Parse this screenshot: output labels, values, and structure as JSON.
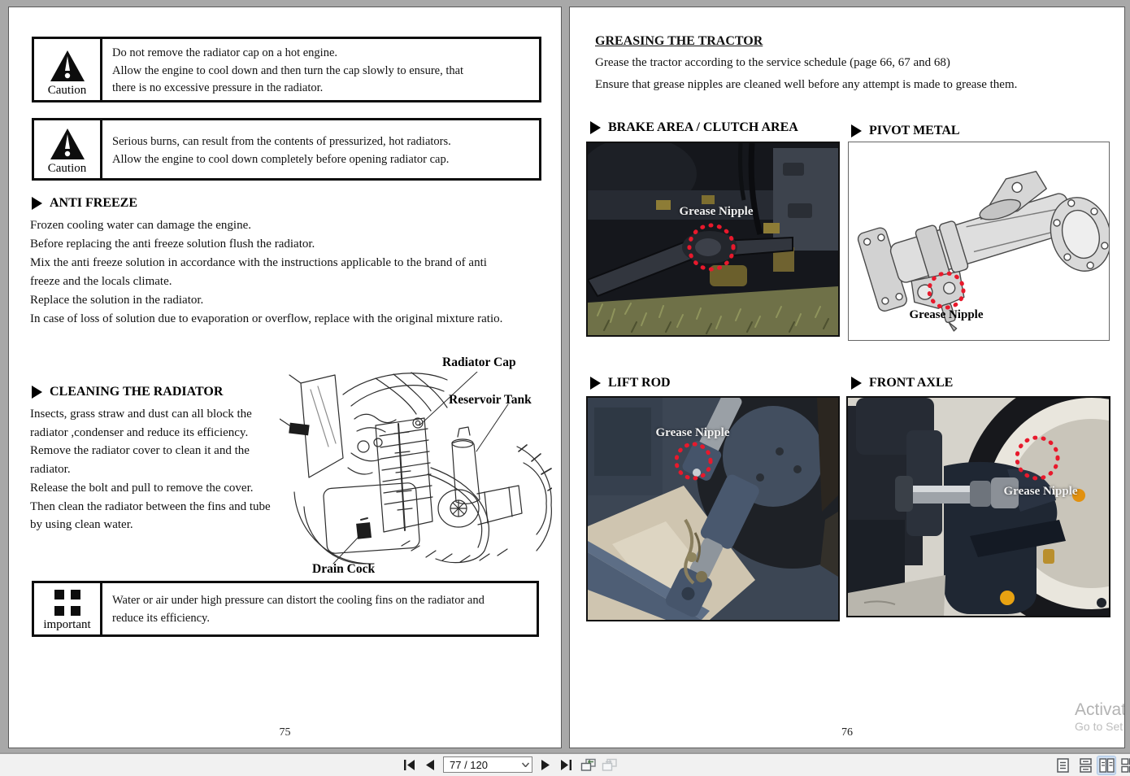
{
  "left_page": {
    "page_number": "75",
    "caution_boxes": [
      {
        "label": "Caution",
        "lines": [
          "Do not remove the radiator cap on a hot engine.",
          "Allow the engine to cool down and then turn the cap slowly to ensure, that",
          "there is no excessive pressure in the radiator."
        ]
      },
      {
        "label": "Caution",
        "lines": [
          "Serious burns, can result from the contents of pressurized, hot radiators.",
          "Allow the engine to cool down completely before opening radiator cap."
        ]
      }
    ],
    "anti_freeze": {
      "heading": "ANTI FREEZE",
      "lines": [
        "Frozen cooling water can damage the engine.",
        "Before replacing the anti freeze solution flush the radiator.",
        "Mix the anti freeze solution in accordance with the instructions applicable to the brand of anti",
        "freeze and the locals climate.",
        "Replace the solution in the radiator.",
        "In case of loss of solution due to evaporation or overflow, replace with the original mixture ratio."
      ]
    },
    "cleaning": {
      "heading": "CLEANING THE RADIATOR",
      "lines": [
        "Insects, grass straw and dust can all block the",
        "radiator ,condenser and reduce its efficiency.",
        "Remove the radiator cover to clean it and the",
        "radiator.",
        "Release the bolt and pull to remove the cover.",
        "Then clean the radiator between the fins and tube",
        "by using clean water."
      ]
    },
    "figure_labels": {
      "radiator_cap": "Radiator Cap",
      "reservoir_tank": "Reservoir Tank",
      "drain_cock": "Drain Cock"
    },
    "important_box": {
      "label": "important",
      "lines": [
        "Water or air under high pressure can distort the cooling fins on the radiator and",
        "reduce its efficiency."
      ]
    }
  },
  "right_page": {
    "page_number": "76",
    "heading": "GREASING THE TRACTOR",
    "intro_lines": [
      "Grease the tractor according to the service schedule (page 66, 67 and 68)",
      "Ensure that grease nipples are cleaned well before any attempt is made to grease them."
    ],
    "panels": [
      {
        "title": "BRAKE AREA / CLUTCH AREA",
        "label": "Grease Nipple"
      },
      {
        "title": "PIVOT METAL",
        "label": "Grease Nipple"
      },
      {
        "title": "LIFT ROD",
        "label": "Grease Nipple"
      },
      {
        "title": "FRONT AXLE",
        "label": "Grease Nipple"
      }
    ]
  },
  "toolbar": {
    "page_indicator": "77 / 120"
  },
  "watermark": {
    "line1": "Activat",
    "line2": "Go to Set"
  },
  "colors": {
    "accent_red": "#e8192c",
    "view_active_bg": "#cfdff2"
  }
}
